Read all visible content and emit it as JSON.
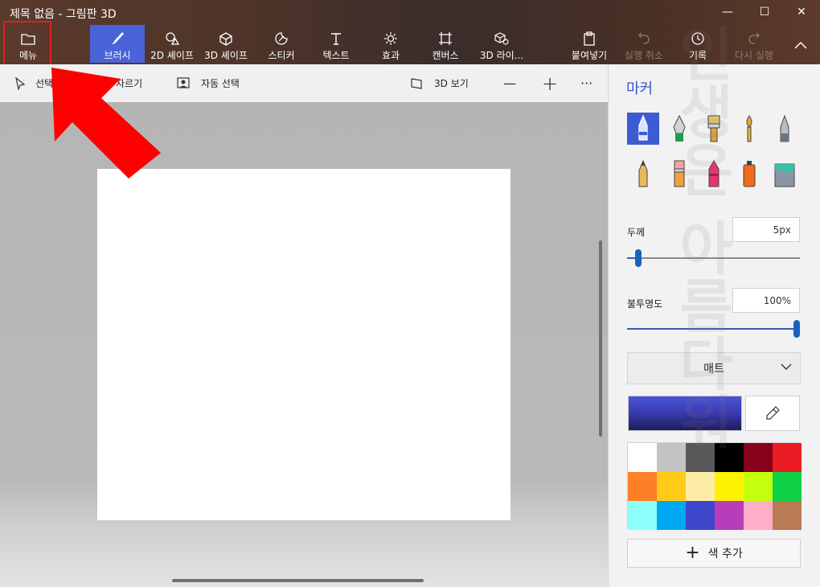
{
  "window": {
    "title": "제목 없음 - 그림판 3D",
    "minimize_glyph": "—",
    "maximize_glyph": "☐",
    "close_glyph": "✕"
  },
  "toolbar": {
    "menu": "메뉴",
    "brushes": "브러시",
    "shapes_2d": "2D 셰이프",
    "shapes_3d": "3D 셰이프",
    "stickers": "스티커",
    "text": "텍스트",
    "effects": "효과",
    "canvas": "캔버스",
    "library_3d": "3D 라이...",
    "paste": "붙여넣기",
    "undo": "실행 취소",
    "history": "기록",
    "redo": "다시 실행"
  },
  "subtoolbar": {
    "select": "선택",
    "crop": "자르기",
    "magic_select": "자동 선택",
    "view_3d": "3D 보기",
    "zoom_out": "—",
    "zoom_in": "+",
    "more": "···"
  },
  "panel": {
    "title": "마커",
    "brushes": [
      "marker",
      "calligraphy-pen",
      "oil-brush",
      "watercolor",
      "pixel-pen",
      "pencil",
      "eraser",
      "crayon",
      "spray-can",
      "fill"
    ],
    "thickness_label": "두께",
    "thickness_value": "5px",
    "thickness_level": 0.05,
    "opacity_label": "불투명도",
    "opacity_value": "100%",
    "opacity_level": 1.0,
    "finish": "매트",
    "current_color": "#3c3cb4",
    "palette": [
      "#ffffff",
      "#c3c3c3",
      "#585858",
      "#000000",
      "#88001b",
      "#ec1c24",
      "#ff7f27",
      "#ffca18",
      "#fdeca6",
      "#fff200",
      "#c4ff0e",
      "#0ed145",
      "#8cfffb",
      "#00a8f3",
      "#3f48cc",
      "#b83dba",
      "#ffaec8",
      "#b97a56"
    ],
    "add_color": "색 추가"
  },
  "watermark": "인생은 아름다워"
}
